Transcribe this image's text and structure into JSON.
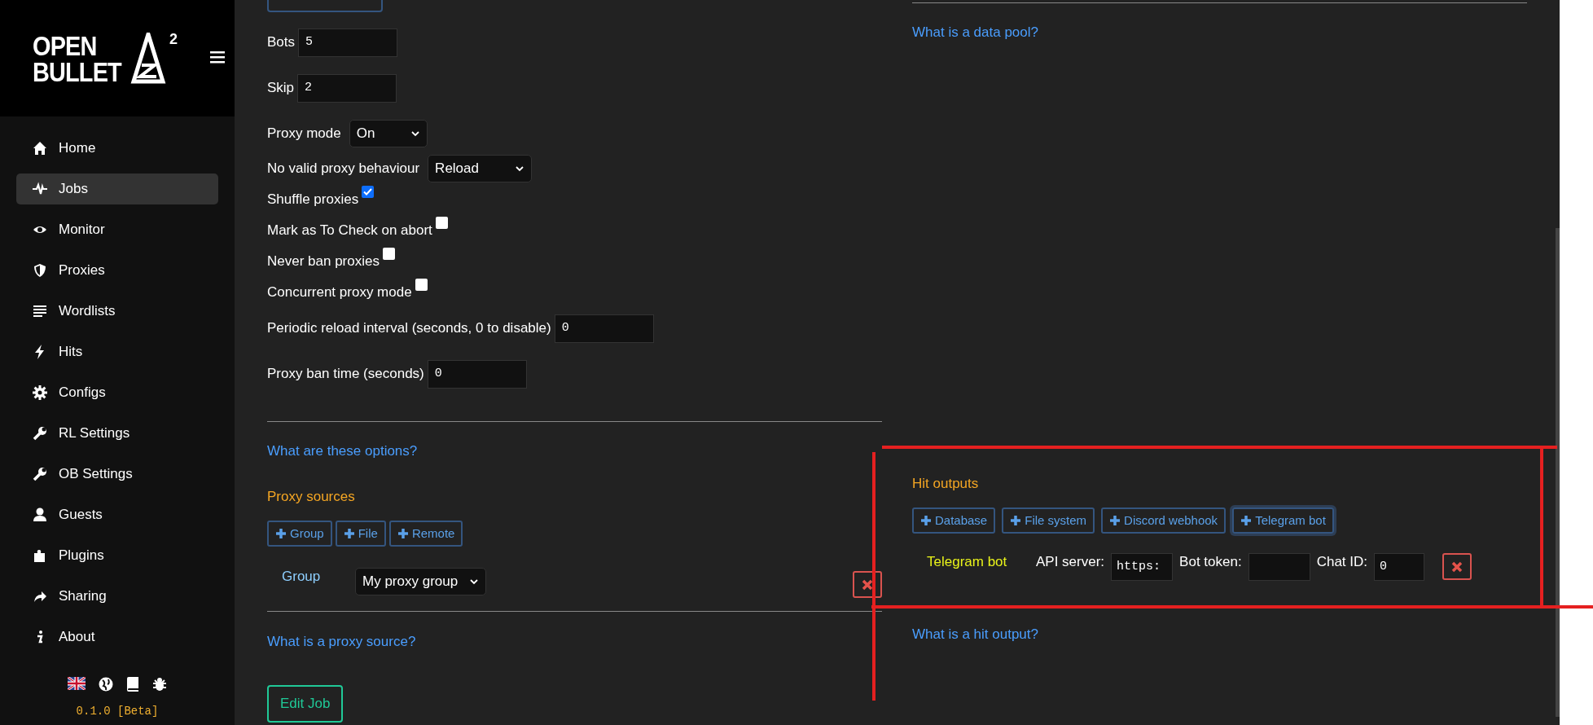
{
  "sidebar": {
    "logo": {
      "line1": "OPEN",
      "line2": "BULLET",
      "superscript": "2"
    },
    "items": [
      {
        "label": "Home",
        "selected": false
      },
      {
        "label": "Jobs",
        "selected": true
      },
      {
        "label": "Monitor",
        "selected": false
      },
      {
        "label": "Proxies",
        "selected": false
      },
      {
        "label": "Wordlists",
        "selected": false
      },
      {
        "label": "Hits",
        "selected": false
      },
      {
        "label": "Configs",
        "selected": false
      },
      {
        "label": "RL Settings",
        "selected": false
      },
      {
        "label": "OB Settings",
        "selected": false
      },
      {
        "label": "Guests",
        "selected": false
      },
      {
        "label": "Plugins",
        "selected": false
      },
      {
        "label": "Sharing",
        "selected": false
      },
      {
        "label": "About",
        "selected": false
      }
    ],
    "version": "0.1.0 [Beta]"
  },
  "proxy_settings": {
    "fields": [
      {
        "kind": "number",
        "label": "Bots",
        "value": "5"
      },
      {
        "kind": "number",
        "label": "Skip",
        "value": "2"
      },
      {
        "kind": "select",
        "label": "Proxy mode",
        "value": "On"
      },
      {
        "kind": "select",
        "label": "No valid proxy behaviour",
        "value": "Reload"
      },
      {
        "kind": "checkbox",
        "label": "Shuffle proxies",
        "checked": true
      },
      {
        "kind": "checkbox",
        "label": "Mark as To Check on abort",
        "checked": false
      },
      {
        "kind": "checkbox",
        "label": "Never ban proxies",
        "checked": false
      },
      {
        "kind": "checkbox",
        "label": "Concurrent proxy mode",
        "checked": false
      },
      {
        "kind": "number",
        "label": "Periodic reload interval (seconds, 0 to disable)",
        "value": "0"
      },
      {
        "kind": "number",
        "label": "Proxy ban time (seconds)",
        "value": "0"
      }
    ],
    "help_link": "What are these options?"
  },
  "proxy_sources": {
    "title": "Proxy sources",
    "add_buttons": [
      "Group",
      "File",
      "Remote"
    ],
    "items": [
      {
        "label": "Group",
        "value": "My proxy group"
      }
    ],
    "help_link": "What is a proxy source?"
  },
  "edit_button": "Edit Job",
  "data_pool": {
    "help_link": "What is a data pool?"
  },
  "hit_outputs": {
    "title": "Hit outputs",
    "add_buttons": [
      {
        "label": "Database",
        "focused": false
      },
      {
        "label": "File system",
        "focused": false
      },
      {
        "label": "Discord webhook",
        "focused": false
      },
      {
        "label": "Telegram bot",
        "focused": true
      }
    ],
    "items": [
      {
        "name": "Telegram bot",
        "fields": [
          {
            "label": "API server:",
            "value": "https:"
          },
          {
            "label": "Bot token:"
          },
          {
            "label": "Chat ID:",
            "value": "0"
          }
        ]
      }
    ],
    "help_link": "What is a hit output?"
  }
}
